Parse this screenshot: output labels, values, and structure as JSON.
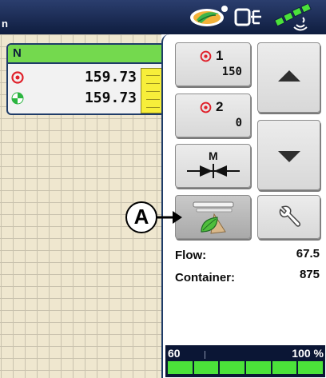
{
  "top_bar": {
    "title_fragment": "n",
    "icons": [
      "leaf-logo-icon",
      "display-usb-icon",
      "gps-signal-icon"
    ]
  },
  "product_overlay": {
    "header": "N",
    "rows": [
      {
        "icon": "target-icon",
        "value": "159.73"
      },
      {
        "icon": "coverage-icon",
        "value": "159.73"
      }
    ]
  },
  "products": [
    {
      "number": "1",
      "rate": "150",
      "icon": "target-icon"
    },
    {
      "number": "2",
      "rate": "0",
      "icon": "target-icon"
    }
  ],
  "controls": {
    "manual_label": "M",
    "up_icon": "arrow-up-icon",
    "down_icon": "arrow-down-icon",
    "wrench_icon": "wrench-icon",
    "container_icon": "seed-container-icon"
  },
  "stats": {
    "flow_label": "Flow:",
    "flow_value": "67.5",
    "container_label": "Container:",
    "container_value": "875"
  },
  "progress": {
    "left_label": "60",
    "right_label": "100 %",
    "segments": 6
  },
  "callout": {
    "letter": "A"
  },
  "colors": {
    "header_green": "#74d94e",
    "topbar_navy": "#12224a",
    "progress_green": "#4be23a",
    "bar_yellow": "#f7ee3a",
    "target_red": "#e0202a"
  }
}
